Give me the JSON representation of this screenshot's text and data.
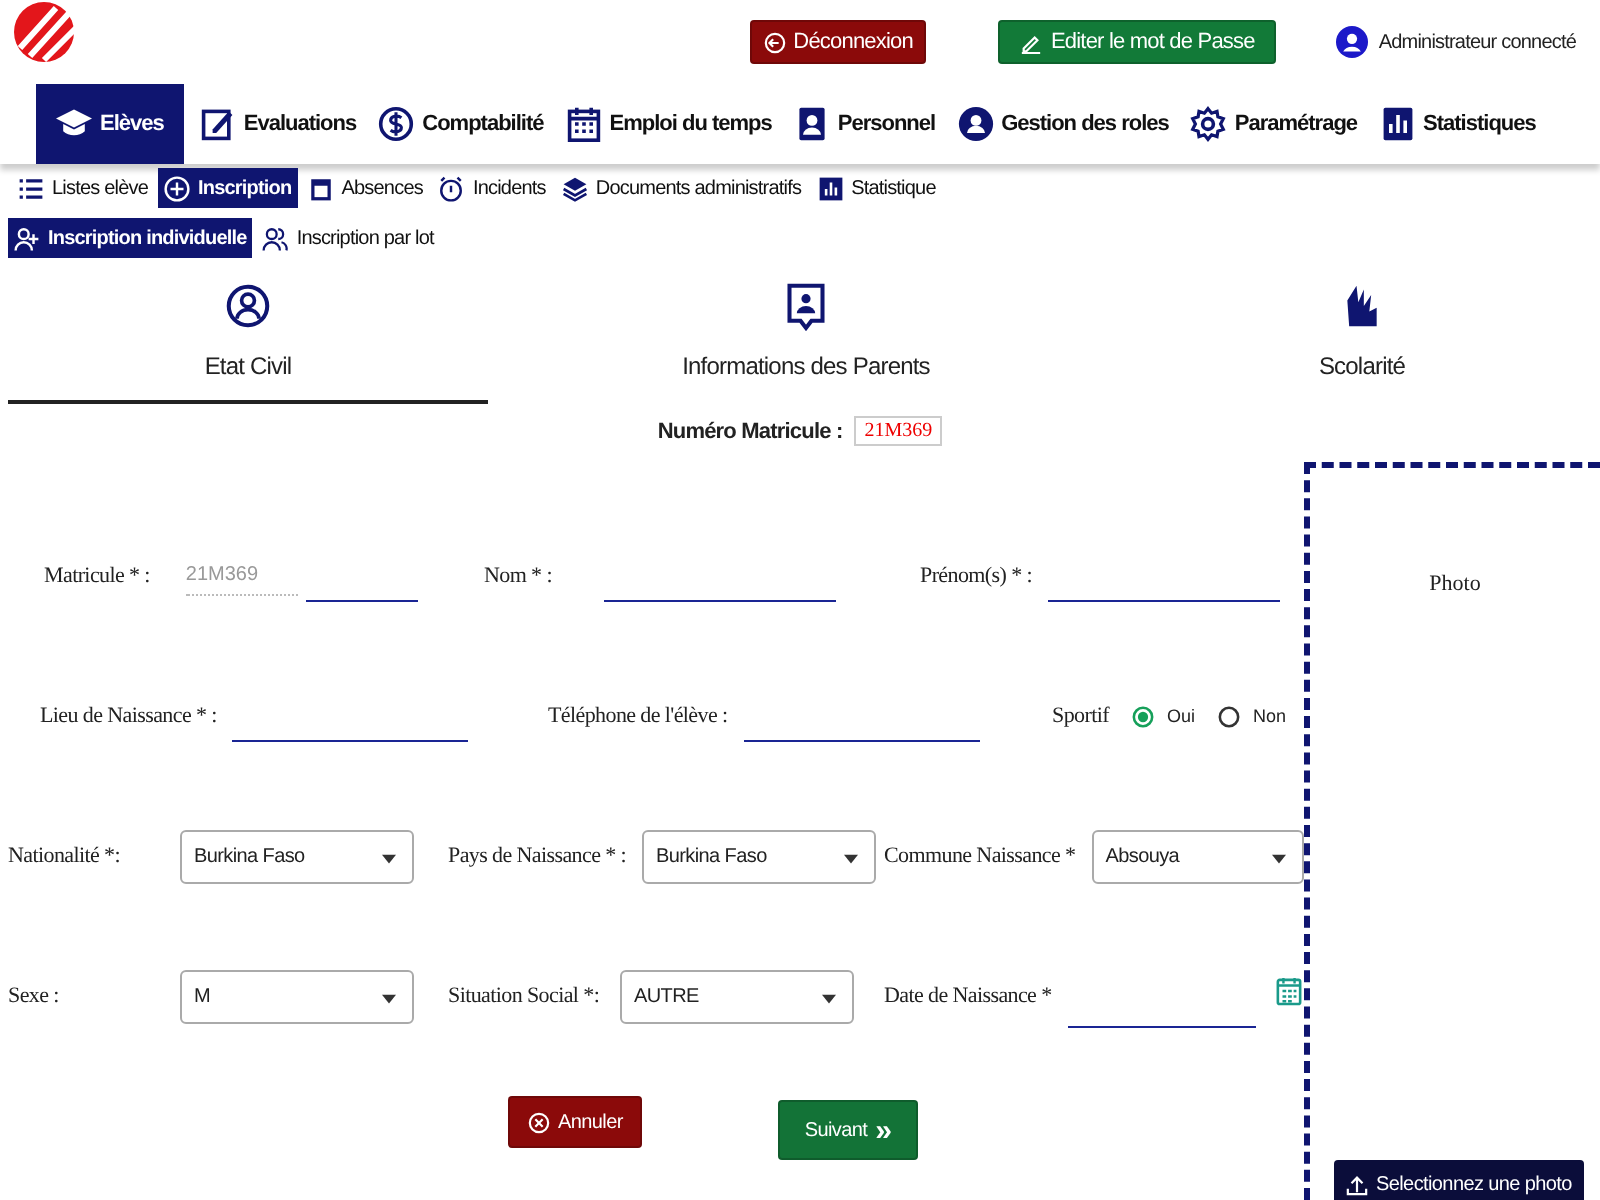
{
  "header": {
    "buttons": [
      {
        "kind": "logout",
        "label": "Déconnexion"
      },
      {
        "kind": "password",
        "label": "Editer le mot de Passe"
      }
    ],
    "user": "Administrateur connecté"
  },
  "nav": [
    {
      "label": "Elèves",
      "selected": true
    },
    {
      "label": "Evaluations",
      "selected": false
    },
    {
      "label": "Comptabilité",
      "selected": false
    },
    {
      "label": "Emploi du temps",
      "selected": false
    },
    {
      "label": "Personnel",
      "selected": false
    },
    {
      "label": "Gestion des roles",
      "selected": false
    },
    {
      "label": "Paramétrage",
      "selected": false
    },
    {
      "label": "Statistiques",
      "selected": false
    }
  ],
  "subnav": [
    {
      "label": "Listes elève",
      "selected": false
    },
    {
      "label": "Inscription",
      "selected": true
    },
    {
      "label": "Absences",
      "selected": false
    },
    {
      "label": "Incidents",
      "selected": false
    },
    {
      "label": "Documents administratifs",
      "selected": false
    },
    {
      "label": "Statistique",
      "selected": false
    }
  ],
  "inscription_tabs": [
    {
      "label": "Inscription individuelle",
      "selected": true
    },
    {
      "label": "Inscription par lot",
      "selected": false
    }
  ],
  "steps": [
    {
      "label": "Etat Civil",
      "selected": true
    },
    {
      "label": "Informations des Parents",
      "selected": false
    },
    {
      "label": "Scolarité",
      "selected": false
    }
  ],
  "matricule_number": {
    "label": "Numéro Matricule :",
    "value": "21M369"
  },
  "form_rows": [
    [
      {
        "kind": "matricule",
        "label": "Matricule  * :",
        "value": "21M369"
      },
      {
        "kind": "text",
        "label": "Nom * :"
      },
      {
        "kind": "text",
        "label": "Prénom(s) * :"
      }
    ],
    [
      {
        "kind": "text",
        "label": "Lieu de Naissance * :"
      },
      {
        "kind": "text",
        "label": "Téléphone de l'élève :"
      },
      {
        "kind": "radio",
        "label": "Sportif",
        "options": [
          {
            "label": "Oui",
            "selected": true
          },
          {
            "label": "Non",
            "selected": false
          }
        ]
      }
    ],
    [
      {
        "kind": "select",
        "label": "Nationalité *:",
        "value": "Burkina Faso"
      },
      {
        "kind": "select",
        "label": "Pays de Naissance * :",
        "value": "Burkina Faso"
      },
      {
        "kind": "select",
        "label": "Commune  Naissance *",
        "value": "Absouya"
      }
    ],
    [
      {
        "kind": "select",
        "label": "Sexe :",
        "value": "M"
      },
      {
        "kind": "select",
        "label": "Situation Social *:",
        "value": "AUTRE"
      },
      {
        "kind": "date",
        "label": "Date de Naissance *"
      }
    ]
  ],
  "actions": [
    {
      "kind": "cancel",
      "label": "Annuler"
    },
    {
      "kind": "next",
      "label": "Suivant",
      "icon_text": "»"
    }
  ],
  "photo": {
    "label": "Photo",
    "button": "Selectionnez une photo"
  }
}
